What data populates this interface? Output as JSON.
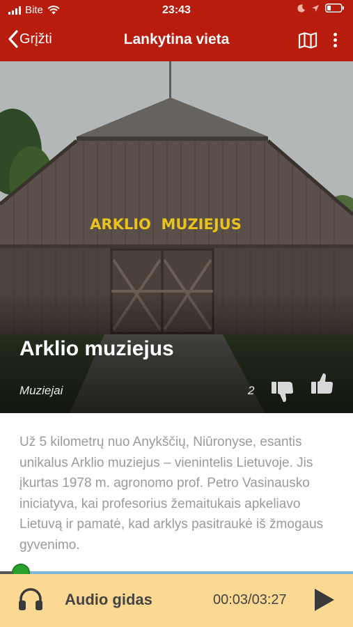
{
  "status_bar": {
    "carrier": "Bite",
    "time": "23:43"
  },
  "nav": {
    "back_label": "Grįžti",
    "title": "Lankytina vieta"
  },
  "place": {
    "title": "Arklio muziejus",
    "category": "Muziejai",
    "likes": "2",
    "sign_text": "ARKLIO  MUZIEJUS",
    "description": "Už 5 kilometrų nuo Anykščių, Niūronyse, esantis unikalus Arklio muziejus – vienintelis Lietuvoje. Jis įkurtas 1978 m. agronomo prof. Petro Vasinausko iniciatyva, kai profesorius žemaitukais apkeliavo Lietuvą ir pamatė, kad arklys pasitraukė iš žmogaus gyvenimo."
  },
  "audio": {
    "label": "Audio gidas",
    "elapsed": "00:03",
    "duration": "03:27",
    "time_display": "00:03/03:27",
    "progress_fraction": 0.06
  },
  "colors": {
    "header": "#b81c0c",
    "audio_bar": "#fbd993",
    "progress_track": "#7bb6d9",
    "progress_knob": "#2aa12f",
    "description_text": "#9a9a9a"
  },
  "icons": {
    "back": "chevron-left-icon",
    "map": "map-icon",
    "more": "more-vertical-icon",
    "dislike": "thumbs-down-icon",
    "like": "thumbs-up-icon",
    "audio": "headphones-icon",
    "play": "play-icon"
  }
}
